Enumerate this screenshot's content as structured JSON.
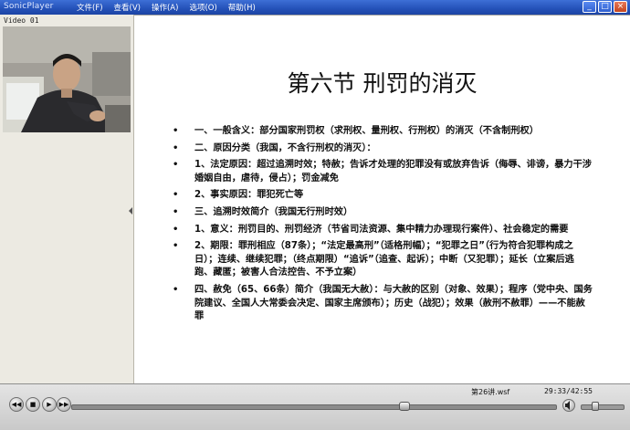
{
  "window": {
    "title": "SonicPlayer",
    "menu": [
      "文件(F)",
      "查看(V)",
      "操作(A)",
      "选项(O)",
      "帮助(H)"
    ],
    "controls": {
      "minimize": "_",
      "maximize": "□",
      "close": "×"
    }
  },
  "video_panel": {
    "label": "Video 01"
  },
  "slide": {
    "title": "第六节 刑罚的消灭",
    "bullets": [
      "一、一般含义：部分国家刑罚权（求刑权、量刑权、行刑权）的消灭（不含制刑权）",
      "二、原因分类（我国，不含行刑权的消灭）：",
      "1、法定原因：超过追溯时效；特赦；告诉才处理的犯罪没有或放弃告诉（侮辱、诽谤，暴力干涉婚姻自由，虐待，侵占）；罚金减免",
      "2、事实原因：罪犯死亡等",
      "三、追溯时效简介（我国无行刑时效）",
      "1、意义：刑罚目的、刑罚经济（节省司法资源、集中精力办理现行案件）、社会稳定的需要",
      "2、期限：罪刑相应（87条）；“法定最高刑”（适格刑幅）；“犯罪之日”（行为符合犯罪构成之日）；连续、继续犯罪；（终点期限）“追诉”（追查、起诉）；中断（又犯罪）；延长（立案后逃跑、藏匿；被害人合法控告、不予立案）",
      "四、赦免（65、66条）简介（我国无大赦）：与大赦的区别（对象、效果）；程序（党中央、国务院建议、全国人大常委会决定、国家主席颁布）；历史（战犯）；效果（赦刑不赦罪）——不能赦罪"
    ]
  },
  "player": {
    "filename": "第26讲.wsf",
    "time": "29:33/42:55",
    "progress": 0.689,
    "volume": 0.35,
    "buttons": {
      "rewind": "◀◀",
      "play": "▶",
      "stop": "■",
      "forward": "▶▶"
    }
  }
}
